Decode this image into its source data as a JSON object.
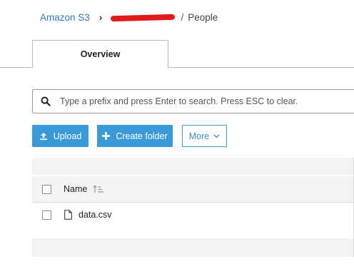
{
  "breadcrumb": {
    "root": "Amazon S3",
    "separator": "›",
    "redacted_segment_color": "#e01b1b",
    "slash": "/",
    "current": "People"
  },
  "tabs": [
    {
      "label": "Overview",
      "active": true
    }
  ],
  "search": {
    "placeholder": "Type a prefix and press Enter to search. Press ESC to clear.",
    "value": "",
    "icon": "search-icon"
  },
  "toolbar": {
    "upload_label": "Upload",
    "upload_icon": "upload-icon",
    "create_folder_label": "Create folder",
    "create_folder_icon": "plus-icon",
    "more_label": "More",
    "more_icon": "chevron-down-icon"
  },
  "table": {
    "columns": [
      {
        "label": "Name",
        "sort_icon": "sort-ascending-icon"
      }
    ],
    "rows": [
      {
        "name": "data.csv",
        "icon": "file-icon",
        "selected": false
      }
    ]
  },
  "colors": {
    "accent": "#3a9ad9",
    "link": "#2d7bbd",
    "band": "#f2f3f3"
  }
}
